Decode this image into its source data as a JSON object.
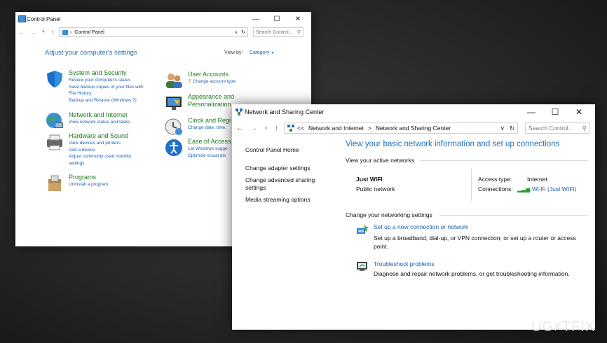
{
  "control_panel": {
    "title": "Control Panel",
    "address": "Control Panel",
    "search_placeholder": "Search Control...",
    "heading": "Adjust your computer's settings",
    "view_by_label": "View by:",
    "view_by_value": "Category",
    "categories": [
      {
        "title": "System and Security",
        "links": [
          "Review your computer's status",
          "Save backup copies of your files with",
          "File History",
          "Backup and Restore (Windows 7)"
        ]
      },
      {
        "title": "Network and Internet",
        "links": [
          "View network status and tasks"
        ]
      },
      {
        "title": "Hardware and Sound",
        "links": [
          "View devices and printers",
          "Add a device",
          "Adjust commonly used mobility",
          "settings"
        ]
      },
      {
        "title": "Programs",
        "links": [
          "Uninstall a program"
        ]
      },
      {
        "title": "User Accounts",
        "links": [
          "Change account type"
        ]
      },
      {
        "title": "Appearance and",
        "title2": "Personalization",
        "links": []
      },
      {
        "title": "Clock and Regi",
        "links": [
          "Change date, time,"
        ]
      },
      {
        "title": "Ease of Access",
        "links": [
          "Let Windows sugge",
          "Optimize visual dis"
        ]
      }
    ]
  },
  "network": {
    "title": "Network and Sharing Center",
    "breadcrumb": [
      "<<",
      "Network and Internet",
      ">",
      "Network and Sharing Center"
    ],
    "search_placeholder": "Search Control...",
    "sidebar": [
      "Control Panel Home",
      "Change adapter settings",
      "Change advanced sharing",
      "settings",
      "Media streaming options"
    ],
    "heading": "View your basic network information and set up connections",
    "active_networks_label": "View your active networks",
    "network_name": "Just WIFI",
    "network_type": "Public network",
    "access_type_label": "Access type:",
    "access_type_value": "Internet",
    "connections_label": "Connections:",
    "connections_value": "Wi-Fi (Just WIFI)",
    "change_settings_label": "Change your networking settings",
    "setup_link": "Set up a new connection or network",
    "setup_desc_1": "Set up a broadband, dial-up, or VPN connection; or set up a router or access",
    "setup_desc_2": "point.",
    "troubleshoot_link": "Troubleshoot problems",
    "troubleshoot_desc": "Diagnose and repair network problems, or get troubleshooting information."
  },
  "watermark": "UG≠TFIX"
}
